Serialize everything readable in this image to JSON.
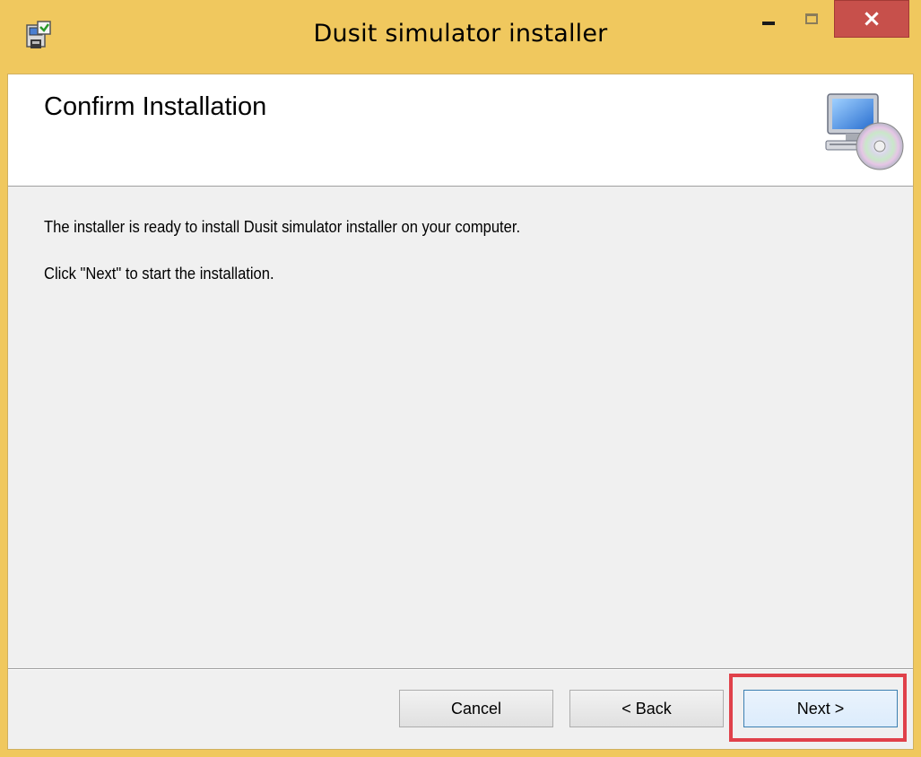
{
  "window": {
    "title": "Dusit simulator installer",
    "titlebar_color": "#f0c85e",
    "close_color": "#c7504b"
  },
  "titlebar_buttons": {
    "minimize_icon": "minimize-icon",
    "maximize_icon": "maximize-icon",
    "close_icon": "close-icon",
    "close_glyph": "×"
  },
  "banner": {
    "title": "Confirm Installation",
    "icon": "computer-cd-icon"
  },
  "body": {
    "line1": "The installer is ready to install Dusit simulator installer on your computer.",
    "line2": "Click \"Next\" to start the installation."
  },
  "buttons": {
    "cancel": "Cancel",
    "back": "< Back",
    "next": "Next >"
  },
  "annotation": {
    "highlight_color": "#e0414a"
  }
}
